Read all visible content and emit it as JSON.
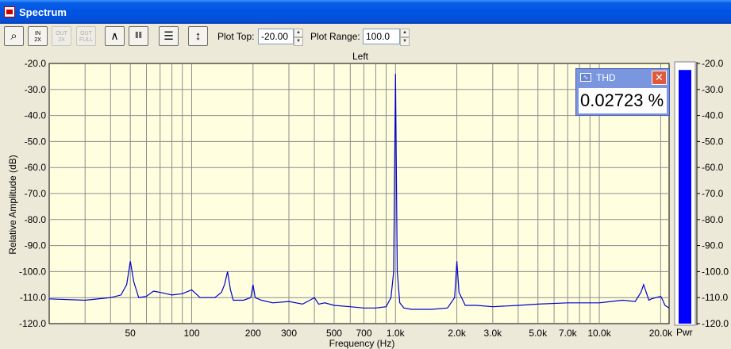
{
  "window": {
    "title": "Spectrum"
  },
  "toolbar": {
    "buttons": [
      {
        "id": "zoom",
        "icon": "magnifier-icon",
        "glyph": "⌕",
        "enabled": true
      },
      {
        "id": "zoom-in-2x",
        "icon": "zoom-in-2x-icon",
        "glyph": "IN 2X",
        "enabled": true
      },
      {
        "id": "zoom-out-2x",
        "icon": "zoom-out-2x-icon",
        "glyph": "OUT 2X",
        "enabled": false
      },
      {
        "id": "zoom-out-full",
        "icon": "zoom-out-full-icon",
        "glyph": "OUT FULL",
        "enabled": false
      },
      {
        "id": "line-view",
        "icon": "line-spectrum-icon",
        "glyph": "∧",
        "enabled": true
      },
      {
        "id": "bar-view",
        "icon": "bar-spectrum-icon",
        "glyph": "‖‖",
        "enabled": true
      },
      {
        "id": "settings",
        "icon": "settings-panel-icon",
        "glyph": "☰",
        "enabled": true
      },
      {
        "id": "autoscale",
        "icon": "vertical-range-icon",
        "glyph": "↕",
        "enabled": true
      }
    ],
    "plot_top_label": "Plot Top:",
    "plot_top_value": "-20.00",
    "plot_range_label": "Plot Range:",
    "plot_range_value": "100.0"
  },
  "thd_panel": {
    "title": "THD",
    "value": "0.02723 %",
    "close_glyph": "✕"
  },
  "meter": {
    "label": "Pwr",
    "level_db": -22.5,
    "bar_color": "#0000ff"
  },
  "chart_data": {
    "type": "line",
    "title": "Left",
    "xlabel": "Frequency (Hz)",
    "ylabel": "Relative Amplitude (dB)",
    "x_scale": "log",
    "xlim": [
      20,
      22000
    ],
    "ylim": [
      -120,
      -20
    ],
    "x_ticks": [
      50,
      100,
      200,
      300,
      500,
      700,
      1000,
      2000,
      3000,
      5000,
      7000,
      10000,
      20000
    ],
    "x_tick_labels": [
      "50",
      "100",
      "200",
      "300",
      "500",
      "700",
      "1.0k",
      "2.0k",
      "3.0k",
      "5.0k",
      "7.0k",
      "10.0k",
      "20.0k"
    ],
    "y_ticks": [
      -20,
      -30,
      -40,
      -50,
      -60,
      -70,
      -80,
      -90,
      -100,
      -110,
      -120
    ],
    "y_tick_labels": [
      "-20.0",
      "-30.0",
      "-40.0",
      "-50.0",
      "-60.0",
      "-70.0",
      "-80.0",
      "-90.0",
      "-100.0",
      "-110.0",
      "-120.0"
    ],
    "grid": true,
    "line_color": "#0000cc",
    "background_color": "#ffffe0",
    "x": [
      20,
      30,
      40,
      45,
      48,
      50,
      52,
      55,
      60,
      65,
      70,
      80,
      90,
      100,
      110,
      130,
      140,
      145,
      150,
      155,
      160,
      180,
      195,
      200,
      205,
      220,
      250,
      300,
      350,
      380,
      400,
      420,
      450,
      500,
      600,
      700,
      800,
      900,
      950,
      980,
      1000,
      1020,
      1050,
      1100,
      1200,
      1500,
      1800,
      1950,
      2000,
      2050,
      2200,
      2500,
      3000,
      4000,
      5000,
      7000,
      10000,
      13000,
      15000,
      16000,
      16500,
      17000,
      17500,
      18000,
      19000,
      20000,
      20500,
      21000,
      22000
    ],
    "y": [
      -110.5,
      -111,
      -110,
      -109,
      -105,
      -96,
      -104,
      -110,
      -109.5,
      -107.5,
      -108,
      -109,
      -108.5,
      -107,
      -110,
      -110,
      -108,
      -105,
      -100,
      -107,
      -111,
      -111,
      -110,
      -105,
      -110,
      -111,
      -112,
      -111.5,
      -112.5,
      -111,
      -110,
      -112.5,
      -112,
      -113,
      -113.5,
      -114,
      -114,
      -113.5,
      -110,
      -100,
      -24,
      -100,
      -112,
      -114,
      -114.5,
      -114.5,
      -114,
      -110,
      -96,
      -108,
      -113,
      -113,
      -113.5,
      -113,
      -112.5,
      -112,
      -112,
      -111,
      -111.5,
      -108,
      -105,
      -108,
      -111,
      -110.5,
      -110,
      -109.5,
      -111,
      -113,
      -114
    ]
  }
}
